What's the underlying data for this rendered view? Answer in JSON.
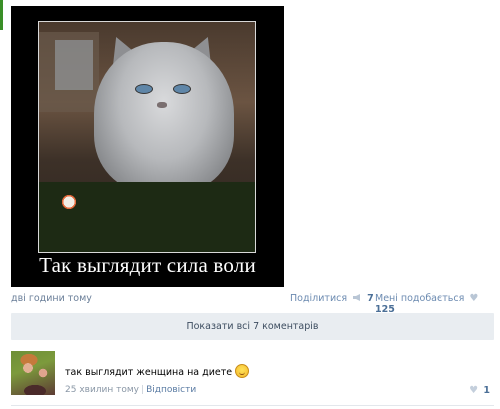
{
  "post": {
    "caption": "Так выглядит сила воли",
    "time": "дві години тому",
    "share_label": "Поділитися",
    "share_count": "7",
    "like_label": "Мені подобається",
    "like_count": "125",
    "show_all_comments": "Показати всі 7 коментарів"
  },
  "comment": {
    "text": "так выглядит женщина на диете",
    "emoji": "laughing-emoji",
    "time": "25 хвилин тому",
    "reply_label": "Відповісти",
    "like_count": "1"
  },
  "colors": {
    "accent": "#3a8f27",
    "link": "#6b8ab0",
    "count": "#4b6f97",
    "panel": "#e9edf1"
  }
}
